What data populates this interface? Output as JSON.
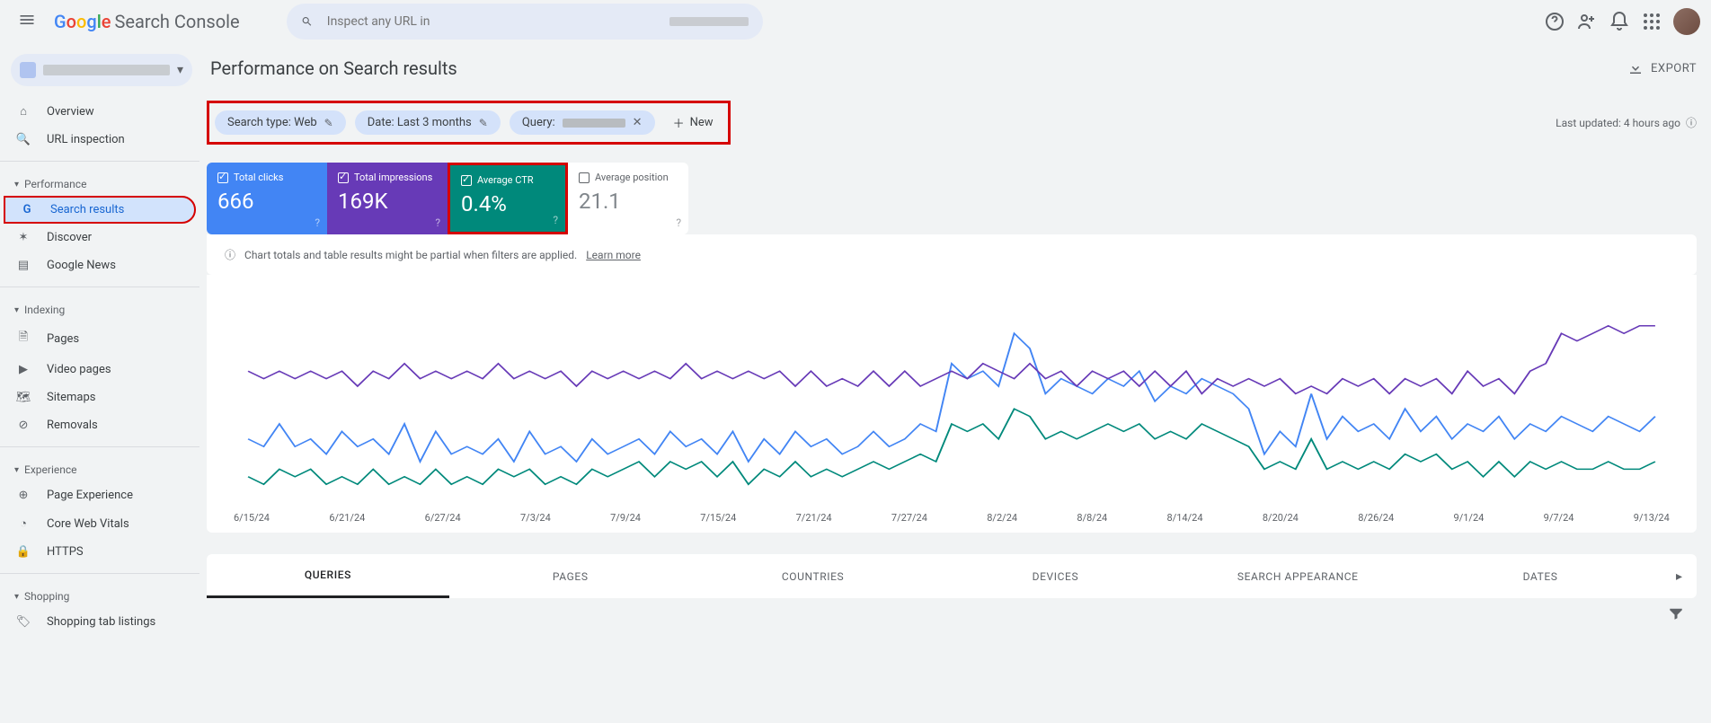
{
  "app_name": "Search Console",
  "search_placeholder": "Inspect any URL in",
  "sidebar": {
    "overview": "Overview",
    "url_inspection": "URL inspection",
    "section_performance": "Performance",
    "search_results": "Search results",
    "discover": "Discover",
    "google_news": "Google News",
    "section_indexing": "Indexing",
    "pages": "Pages",
    "video_pages": "Video pages",
    "sitemaps": "Sitemaps",
    "removals": "Removals",
    "section_experience": "Experience",
    "page_experience": "Page Experience",
    "core_web_vitals": "Core Web Vitals",
    "https": "HTTPS",
    "section_shopping": "Shopping",
    "shopping_tab": "Shopping tab listings"
  },
  "page_title": "Performance on Search results",
  "export_label": "EXPORT",
  "filters": {
    "search_type": "Search type: Web",
    "date": "Date: Last 3 months",
    "query_label": "Query:",
    "new_label": "New"
  },
  "last_updated": "Last updated: 4 hours ago",
  "metrics": {
    "clicks_label": "Total clicks",
    "clicks_value": "666",
    "impressions_label": "Total impressions",
    "impressions_value": "169K",
    "ctr_label": "Average CTR",
    "ctr_value": "0.4%",
    "position_label": "Average position",
    "position_value": "21.1"
  },
  "notice_text": "Chart totals and table results might be partial when filters are applied.",
  "notice_link": "Learn more",
  "tabs": {
    "queries": "QUERIES",
    "pages": "PAGES",
    "countries": "COUNTRIES",
    "devices": "DEVICES",
    "search_appearance": "SEARCH APPEARANCE",
    "dates": "DATES"
  },
  "chart_data": {
    "type": "line",
    "x_labels": [
      "6/15/24",
      "6/21/24",
      "6/27/24",
      "7/3/24",
      "7/9/24",
      "7/15/24",
      "7/21/24",
      "7/27/24",
      "8/2/24",
      "8/8/24",
      "8/14/24",
      "8/20/24",
      "8/26/24",
      "9/1/24",
      "9/7/24",
      "9/13/24"
    ],
    "series": [
      {
        "name": "Clicks",
        "color": "#4285f4",
        "values": [
          8,
          7,
          10,
          7,
          8,
          6,
          9,
          7,
          8,
          6,
          10,
          5,
          9,
          6,
          7,
          6,
          8,
          5,
          9,
          6,
          7,
          5,
          8,
          6,
          7,
          8,
          6,
          9,
          7,
          8,
          6,
          9,
          5,
          8,
          6,
          9,
          7,
          8,
          6,
          7,
          9,
          7,
          8,
          10,
          9,
          18,
          16,
          17,
          15,
          22,
          20,
          14,
          16,
          15,
          14,
          16,
          15,
          17,
          13,
          15,
          14,
          16,
          15,
          14,
          12,
          6,
          9,
          7,
          14,
          8,
          11,
          9,
          10,
          8,
          12,
          9,
          11,
          8,
          10,
          9,
          11,
          8,
          10,
          9,
          11,
          10,
          9,
          11,
          10,
          9,
          11
        ]
      },
      {
        "name": "Impressions",
        "color": "#673ab7",
        "values": [
          17,
          16,
          17,
          16,
          17,
          16,
          17,
          15,
          17,
          16,
          18,
          16,
          17,
          16,
          17,
          16,
          18,
          16,
          17,
          16,
          17,
          15,
          17,
          16,
          17,
          16,
          17,
          16,
          18,
          16,
          17,
          16,
          17,
          16,
          17,
          15,
          17,
          15,
          16,
          15,
          17,
          15,
          17,
          15,
          16,
          17,
          16,
          18,
          17,
          16,
          18,
          16,
          17,
          15,
          17,
          16,
          17,
          15,
          17,
          15,
          17,
          14,
          16,
          15,
          16,
          15,
          16,
          14,
          15,
          14,
          16,
          15,
          16,
          14,
          16,
          15,
          16,
          14,
          17,
          15,
          16,
          14,
          17,
          18,
          22,
          21,
          22,
          23,
          22,
          23,
          23
        ]
      },
      {
        "name": "CTR",
        "color": "#00897b",
        "values": [
          3,
          2,
          4,
          3,
          4,
          2,
          3,
          2,
          4,
          2,
          3,
          2,
          4,
          2,
          3,
          2,
          4,
          3,
          4,
          2,
          3,
          2,
          4,
          3,
          4,
          5,
          3,
          5,
          4,
          5,
          3,
          5,
          2,
          4,
          3,
          5,
          3,
          4,
          3,
          4,
          5,
          4,
          5,
          6,
          5,
          10,
          9,
          10,
          8,
          12,
          11,
          8,
          9,
          8,
          9,
          10,
          9,
          10,
          8,
          9,
          8,
          10,
          9,
          8,
          7,
          4,
          5,
          4,
          8,
          4,
          5,
          4,
          5,
          4,
          6,
          5,
          6,
          4,
          5,
          3,
          5,
          3,
          5,
          4,
          5,
          4,
          4,
          5,
          4,
          4,
          5
        ]
      }
    ],
    "y_max": 25
  }
}
